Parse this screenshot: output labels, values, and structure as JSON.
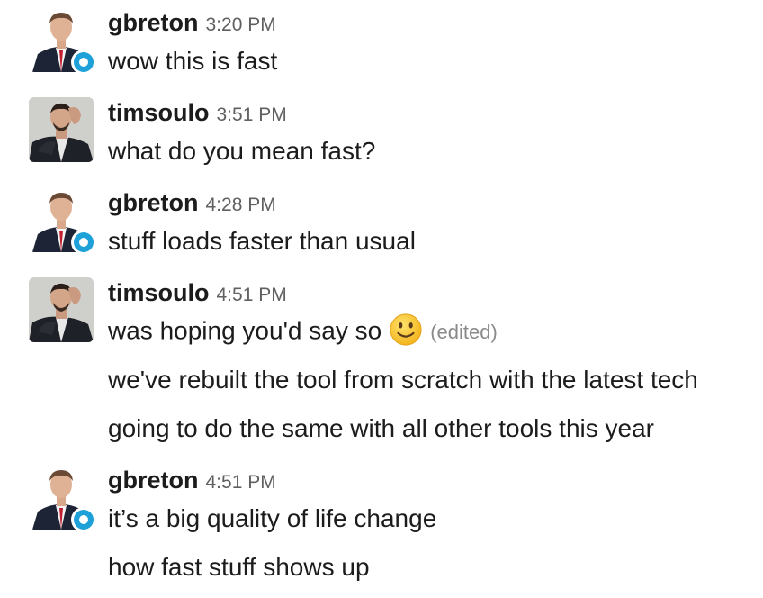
{
  "messages": [
    {
      "user": "gbreton",
      "time": "3:20 PM",
      "lines": [
        "wow this is fast"
      ]
    },
    {
      "user": "timsoulo",
      "time": "3:51 PM",
      "lines": [
        "what do you mean fast?"
      ]
    },
    {
      "user": "gbreton",
      "time": "4:28 PM",
      "lines": [
        "stuff loads faster than usual"
      ]
    },
    {
      "user": "timsoulo",
      "time": "4:51 PM",
      "lines": [
        "was hoping you'd say so",
        "we've rebuilt the tool from scratch with the latest tech",
        "going to do the same with all other tools this year"
      ],
      "edited_label": "(edited)",
      "emoji": "slightly-smiling-face"
    },
    {
      "user": "gbreton",
      "time": "4:51 PM",
      "lines": [
        "it’s a big quality of life change",
        "how fast stuff shows up"
      ]
    }
  ],
  "colors": {
    "presence": "#1ea1d8",
    "timestamp": "#616061",
    "text": "#1d1c1d"
  }
}
